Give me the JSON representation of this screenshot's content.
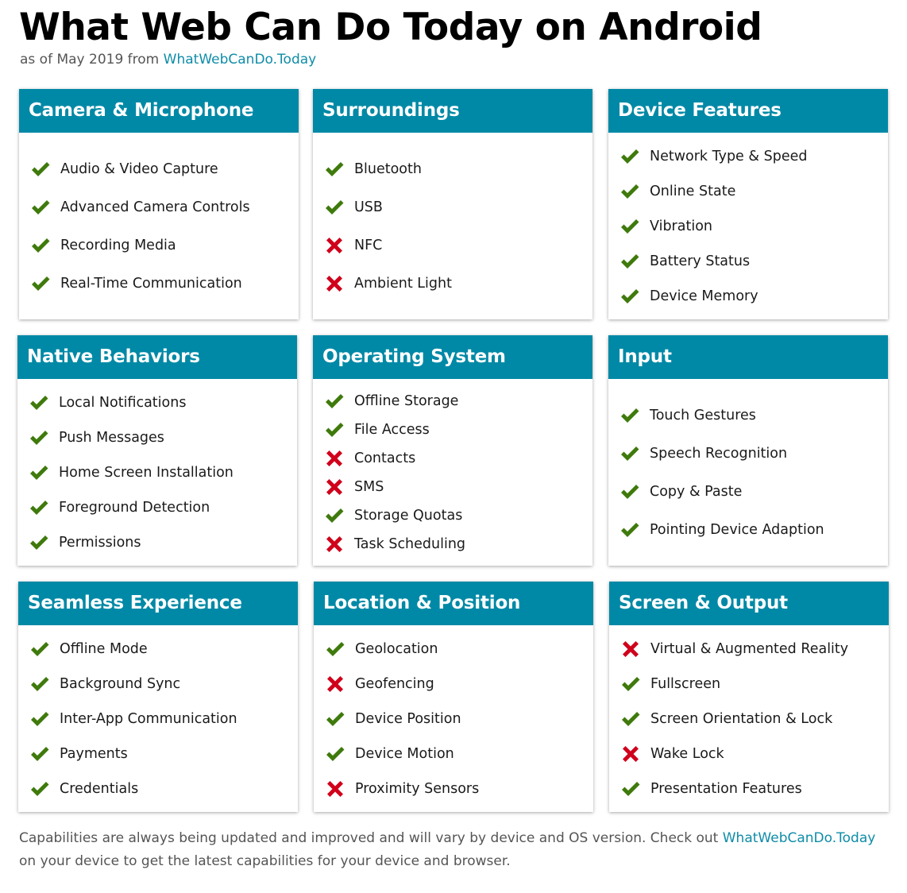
{
  "header": {
    "title": "What Web Can Do Today on Android",
    "subtitle_prefix": "as of May 2019 from ",
    "subtitle_link": "WhatWebCanDo.Today"
  },
  "colors": {
    "header_bg": "#0089a6",
    "supported": "#3f7a0c",
    "unsupported": "#d0021b",
    "link": "#0f8ca8"
  },
  "categories": [
    {
      "title": "Camera & Microphone",
      "features": [
        {
          "label": "Audio & Video Capture",
          "supported": true
        },
        {
          "label": "Advanced Camera Controls",
          "supported": true
        },
        {
          "label": "Recording Media",
          "supported": true
        },
        {
          "label": "Real-Time Communication",
          "supported": true
        }
      ]
    },
    {
      "title": "Surroundings",
      "features": [
        {
          "label": "Bluetooth",
          "supported": true
        },
        {
          "label": "USB",
          "supported": true
        },
        {
          "label": "NFC",
          "supported": false
        },
        {
          "label": "Ambient Light",
          "supported": false
        }
      ]
    },
    {
      "title": "Device Features",
      "features": [
        {
          "label": "Network Type & Speed",
          "supported": true
        },
        {
          "label": "Online State",
          "supported": true
        },
        {
          "label": "Vibration",
          "supported": true
        },
        {
          "label": "Battery Status",
          "supported": true
        },
        {
          "label": "Device Memory",
          "supported": true
        }
      ]
    },
    {
      "title": "Native Behaviors",
      "features": [
        {
          "label": "Local Notifications",
          "supported": true
        },
        {
          "label": "Push Messages",
          "supported": true
        },
        {
          "label": "Home Screen Installation",
          "supported": true
        },
        {
          "label": "Foreground Detection",
          "supported": true
        },
        {
          "label": "Permissions",
          "supported": true
        }
      ]
    },
    {
      "title": "Operating System",
      "features": [
        {
          "label": "Offline Storage",
          "supported": true
        },
        {
          "label": "File Access",
          "supported": true
        },
        {
          "label": "Contacts",
          "supported": false
        },
        {
          "label": "SMS",
          "supported": false
        },
        {
          "label": "Storage Quotas",
          "supported": true
        },
        {
          "label": "Task Scheduling",
          "supported": false
        }
      ]
    },
    {
      "title": "Input",
      "features": [
        {
          "label": "Touch Gestures",
          "supported": true
        },
        {
          "label": "Speech Recognition",
          "supported": true
        },
        {
          "label": "Copy & Paste",
          "supported": true
        },
        {
          "label": "Pointing Device Adaption",
          "supported": true
        }
      ]
    },
    {
      "title": "Seamless Experience",
      "features": [
        {
          "label": "Offline Mode",
          "supported": true
        },
        {
          "label": "Background Sync",
          "supported": true
        },
        {
          "label": "Inter-App Communication",
          "supported": true
        },
        {
          "label": "Payments",
          "supported": true
        },
        {
          "label": "Credentials",
          "supported": true
        }
      ]
    },
    {
      "title": "Location & Position",
      "features": [
        {
          "label": "Geolocation",
          "supported": true
        },
        {
          "label": "Geofencing",
          "supported": false
        },
        {
          "label": "Device Position",
          "supported": true
        },
        {
          "label": "Device Motion",
          "supported": true
        },
        {
          "label": "Proximity Sensors",
          "supported": false
        }
      ]
    },
    {
      "title": "Screen & Output",
      "features": [
        {
          "label": "Virtual & Augmented Reality",
          "supported": false
        },
        {
          "label": "Fullscreen",
          "supported": true
        },
        {
          "label": "Screen Orientation & Lock",
          "supported": true
        },
        {
          "label": "Wake Lock",
          "supported": false
        },
        {
          "label": "Presentation Features",
          "supported": true
        }
      ]
    }
  ],
  "footer": {
    "text_before": "Capabilities are always being updated and improved and will vary by device and OS version. Check out ",
    "link": "WhatWebCanDo.Today",
    "text_after": " on your device to get the latest capabilities for your device and browser."
  }
}
